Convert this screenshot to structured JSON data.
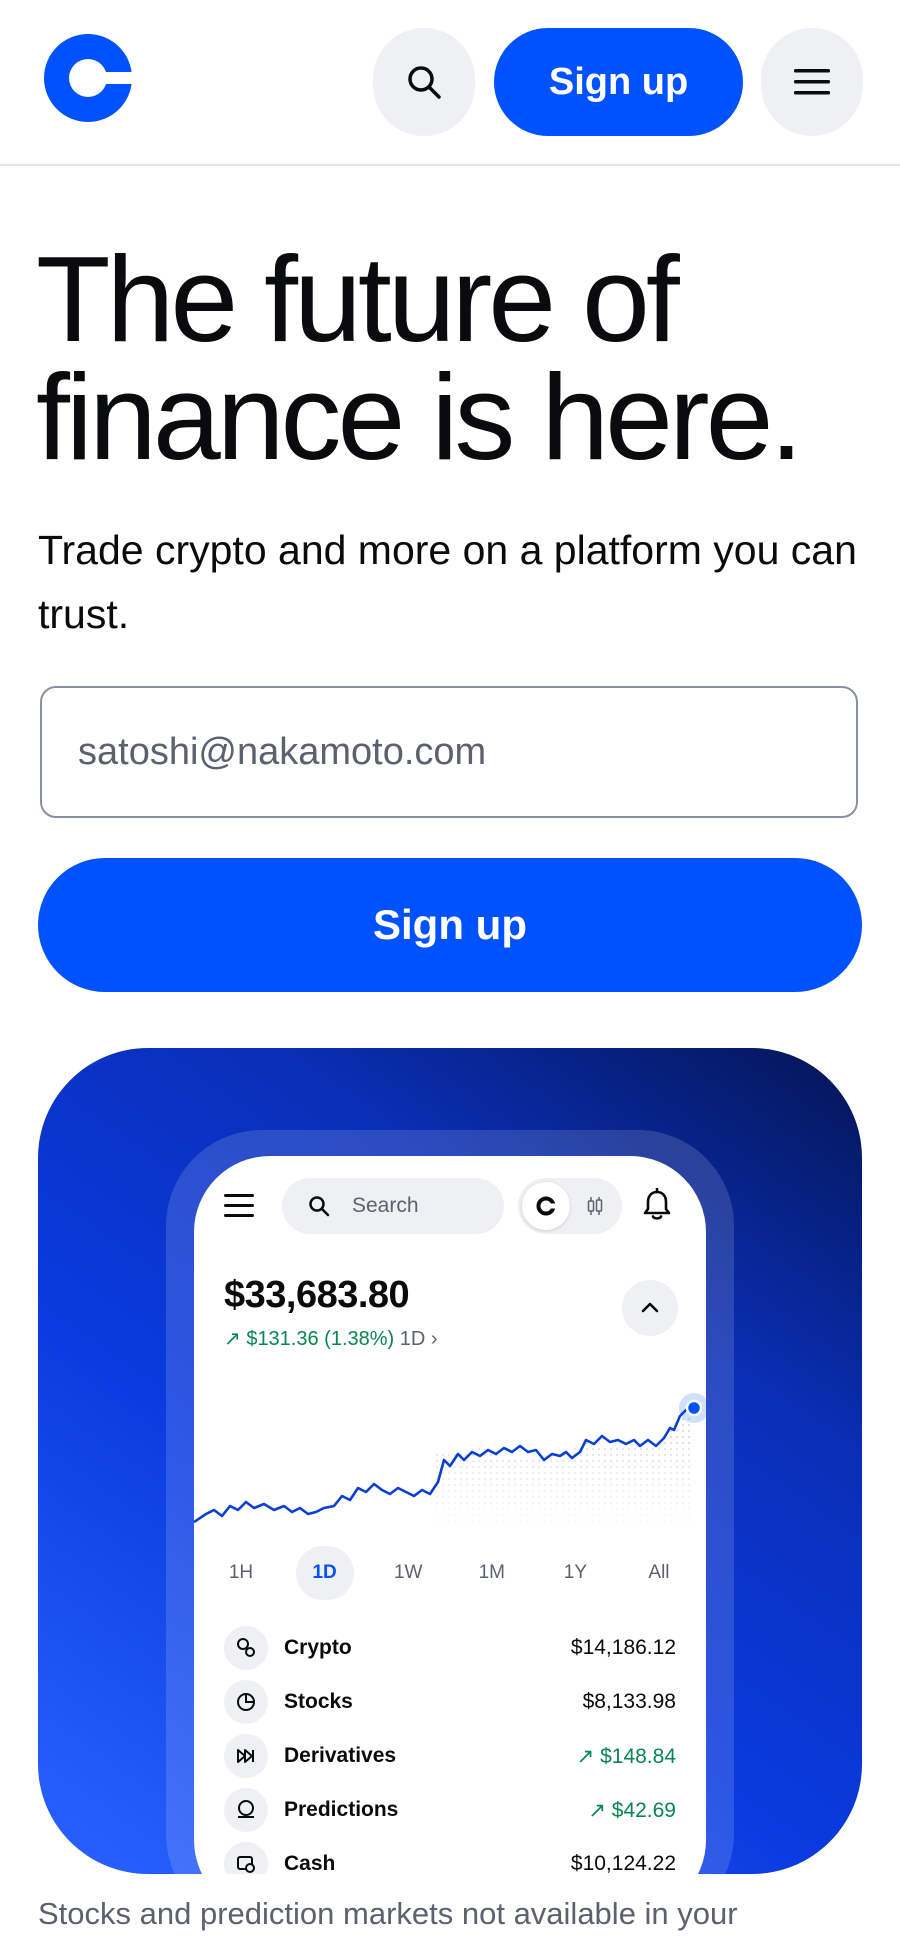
{
  "header": {
    "signup_label": "Sign up"
  },
  "hero": {
    "title_line1": "The future of",
    "title_line2": "finance is here.",
    "subtitle": "Trade crypto and more on a platform you can trust.",
    "email_placeholder": "satoshi@nakamoto.com",
    "signup_label": "Sign up"
  },
  "app_preview": {
    "search_placeholder": "Search",
    "balance": "$33,683.80",
    "change_value": "↗ $131.36 (1.38%)",
    "change_period": "1D",
    "ranges": [
      "1H",
      "1D",
      "1W",
      "1M",
      "1Y",
      "All"
    ],
    "active_range": "1D",
    "rows": [
      {
        "name": "Crypto",
        "value": "$14,186.12",
        "trend": "neutral"
      },
      {
        "name": "Stocks",
        "value": "$8,133.98",
        "trend": "neutral"
      },
      {
        "name": "Derivatives",
        "value": "↗ $148.84",
        "trend": "up"
      },
      {
        "name": "Predictions",
        "value": "↗ $42.69",
        "trend": "up"
      },
      {
        "name": "Cash",
        "value": "$10,124.22",
        "trend": "neutral"
      }
    ]
  },
  "footnote": "Stocks and prediction markets not available in your",
  "colors": {
    "brand_blue": "#0052ff",
    "positive_green": "#098551",
    "text_primary": "#0a0b0d",
    "text_secondary": "#5b616e"
  }
}
